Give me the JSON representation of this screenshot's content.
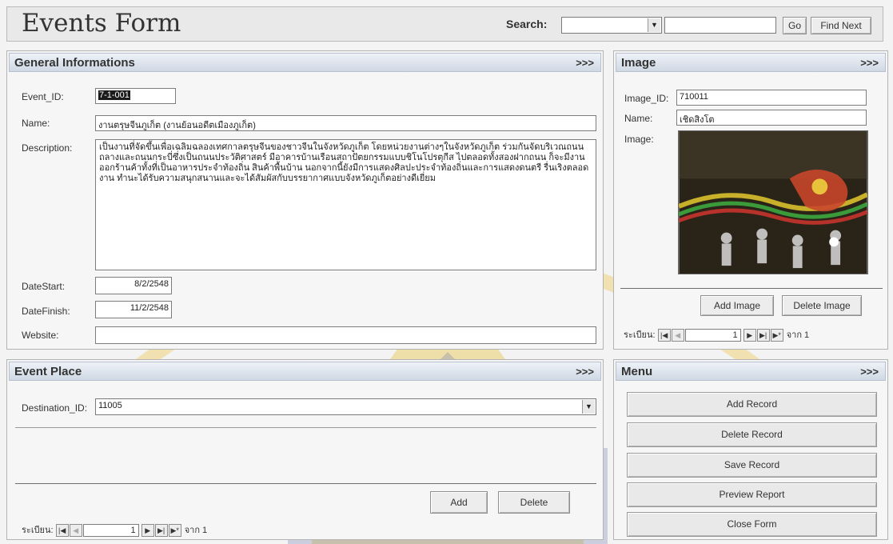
{
  "header": {
    "title": "Events Form",
    "search_label": "Search:",
    "go_label": "Go",
    "find_next_label": "Find Next"
  },
  "general": {
    "title": "General Informations",
    "more": ">>>",
    "event_id_label": "Event_ID:",
    "event_id": "7-1-001",
    "name_label": "Name:",
    "name": "งานตรุษจีนภูเก็ต (งานย้อนอดีตเมืองภูเก็ต)",
    "description_label": "Description:",
    "description": "เป็นงานที่จัดขึ้นเพื่อเฉลิมฉลองเทศกาลตรุษจีนของชาวจีนในจังหวัดภูเก็ต โดยหน่วยงานต่างๆในจังหวัดภูเก็ต ร่วมกันจัดบริเวณถนนถลางและถนนกระบี่ซึ่งเป็นถนนประวัติศาสตร์ มีอาคารบ้านเรือนสถาปัตยกรรมแบบชิโนโปรตุกีส ไปตลอดทั้งสองฝากถนน ก็จะมีงานออกร้านค้าทั้งที่เป็นอาหารประจำท้องถิ่น สินค้าพื้นบ้าน นอกจากนี้ยังมีการแสดงศิลปะประจำท้องถิ่นและการแสดงดนตรี รื่นเริงตลอดงาน ทำนะได้รับความสนุกสนานและจะได้สัมผัสกับบรรยากาศแบบจังหวัดภูเก็ตอย่างดีเยี่ยม",
    "date_start_label": "DateStart:",
    "date_start": "8/2/2548",
    "date_finish_label": "DateFinish:",
    "date_finish": "11/2/2548",
    "website_label": "Website:",
    "website": ""
  },
  "image": {
    "title": "Image",
    "more": ">>>",
    "image_id_label": "Image_ID:",
    "image_id": "710011",
    "name_label": "Name:",
    "name": "เชิดสิงโต",
    "image_label": "Image:",
    "add_label": "Add Image",
    "delete_label": "Delete Image",
    "nav": {
      "record_label": "ระเบียน:",
      "current": "1",
      "of_label": "จาก 1"
    }
  },
  "place": {
    "title": "Event Place",
    "more": ">>>",
    "destination_label": "Destination_ID:",
    "destination": "11005",
    "add_label": "Add",
    "delete_label": "Delete",
    "nav": {
      "record_label": "ระเบียน:",
      "current": "1",
      "of_label": "จาก 1"
    }
  },
  "menu": {
    "title": "Menu",
    "more": ">>>",
    "items": [
      "Add Record",
      "Delete Record",
      "Save Record",
      "Preview Report",
      "Close Form"
    ]
  },
  "icons": {
    "nav_first": "first-record-icon",
    "nav_prev": "prev-record-icon",
    "nav_next": "next-record-icon",
    "nav_last": "last-record-icon",
    "nav_new": "new-record-icon",
    "dropdown": "chevron-down-icon"
  },
  "colors": {
    "panel_header_top": "#eef2f8",
    "panel_header_bottom": "#cfd8e4",
    "watermark": "#e8c95a"
  }
}
